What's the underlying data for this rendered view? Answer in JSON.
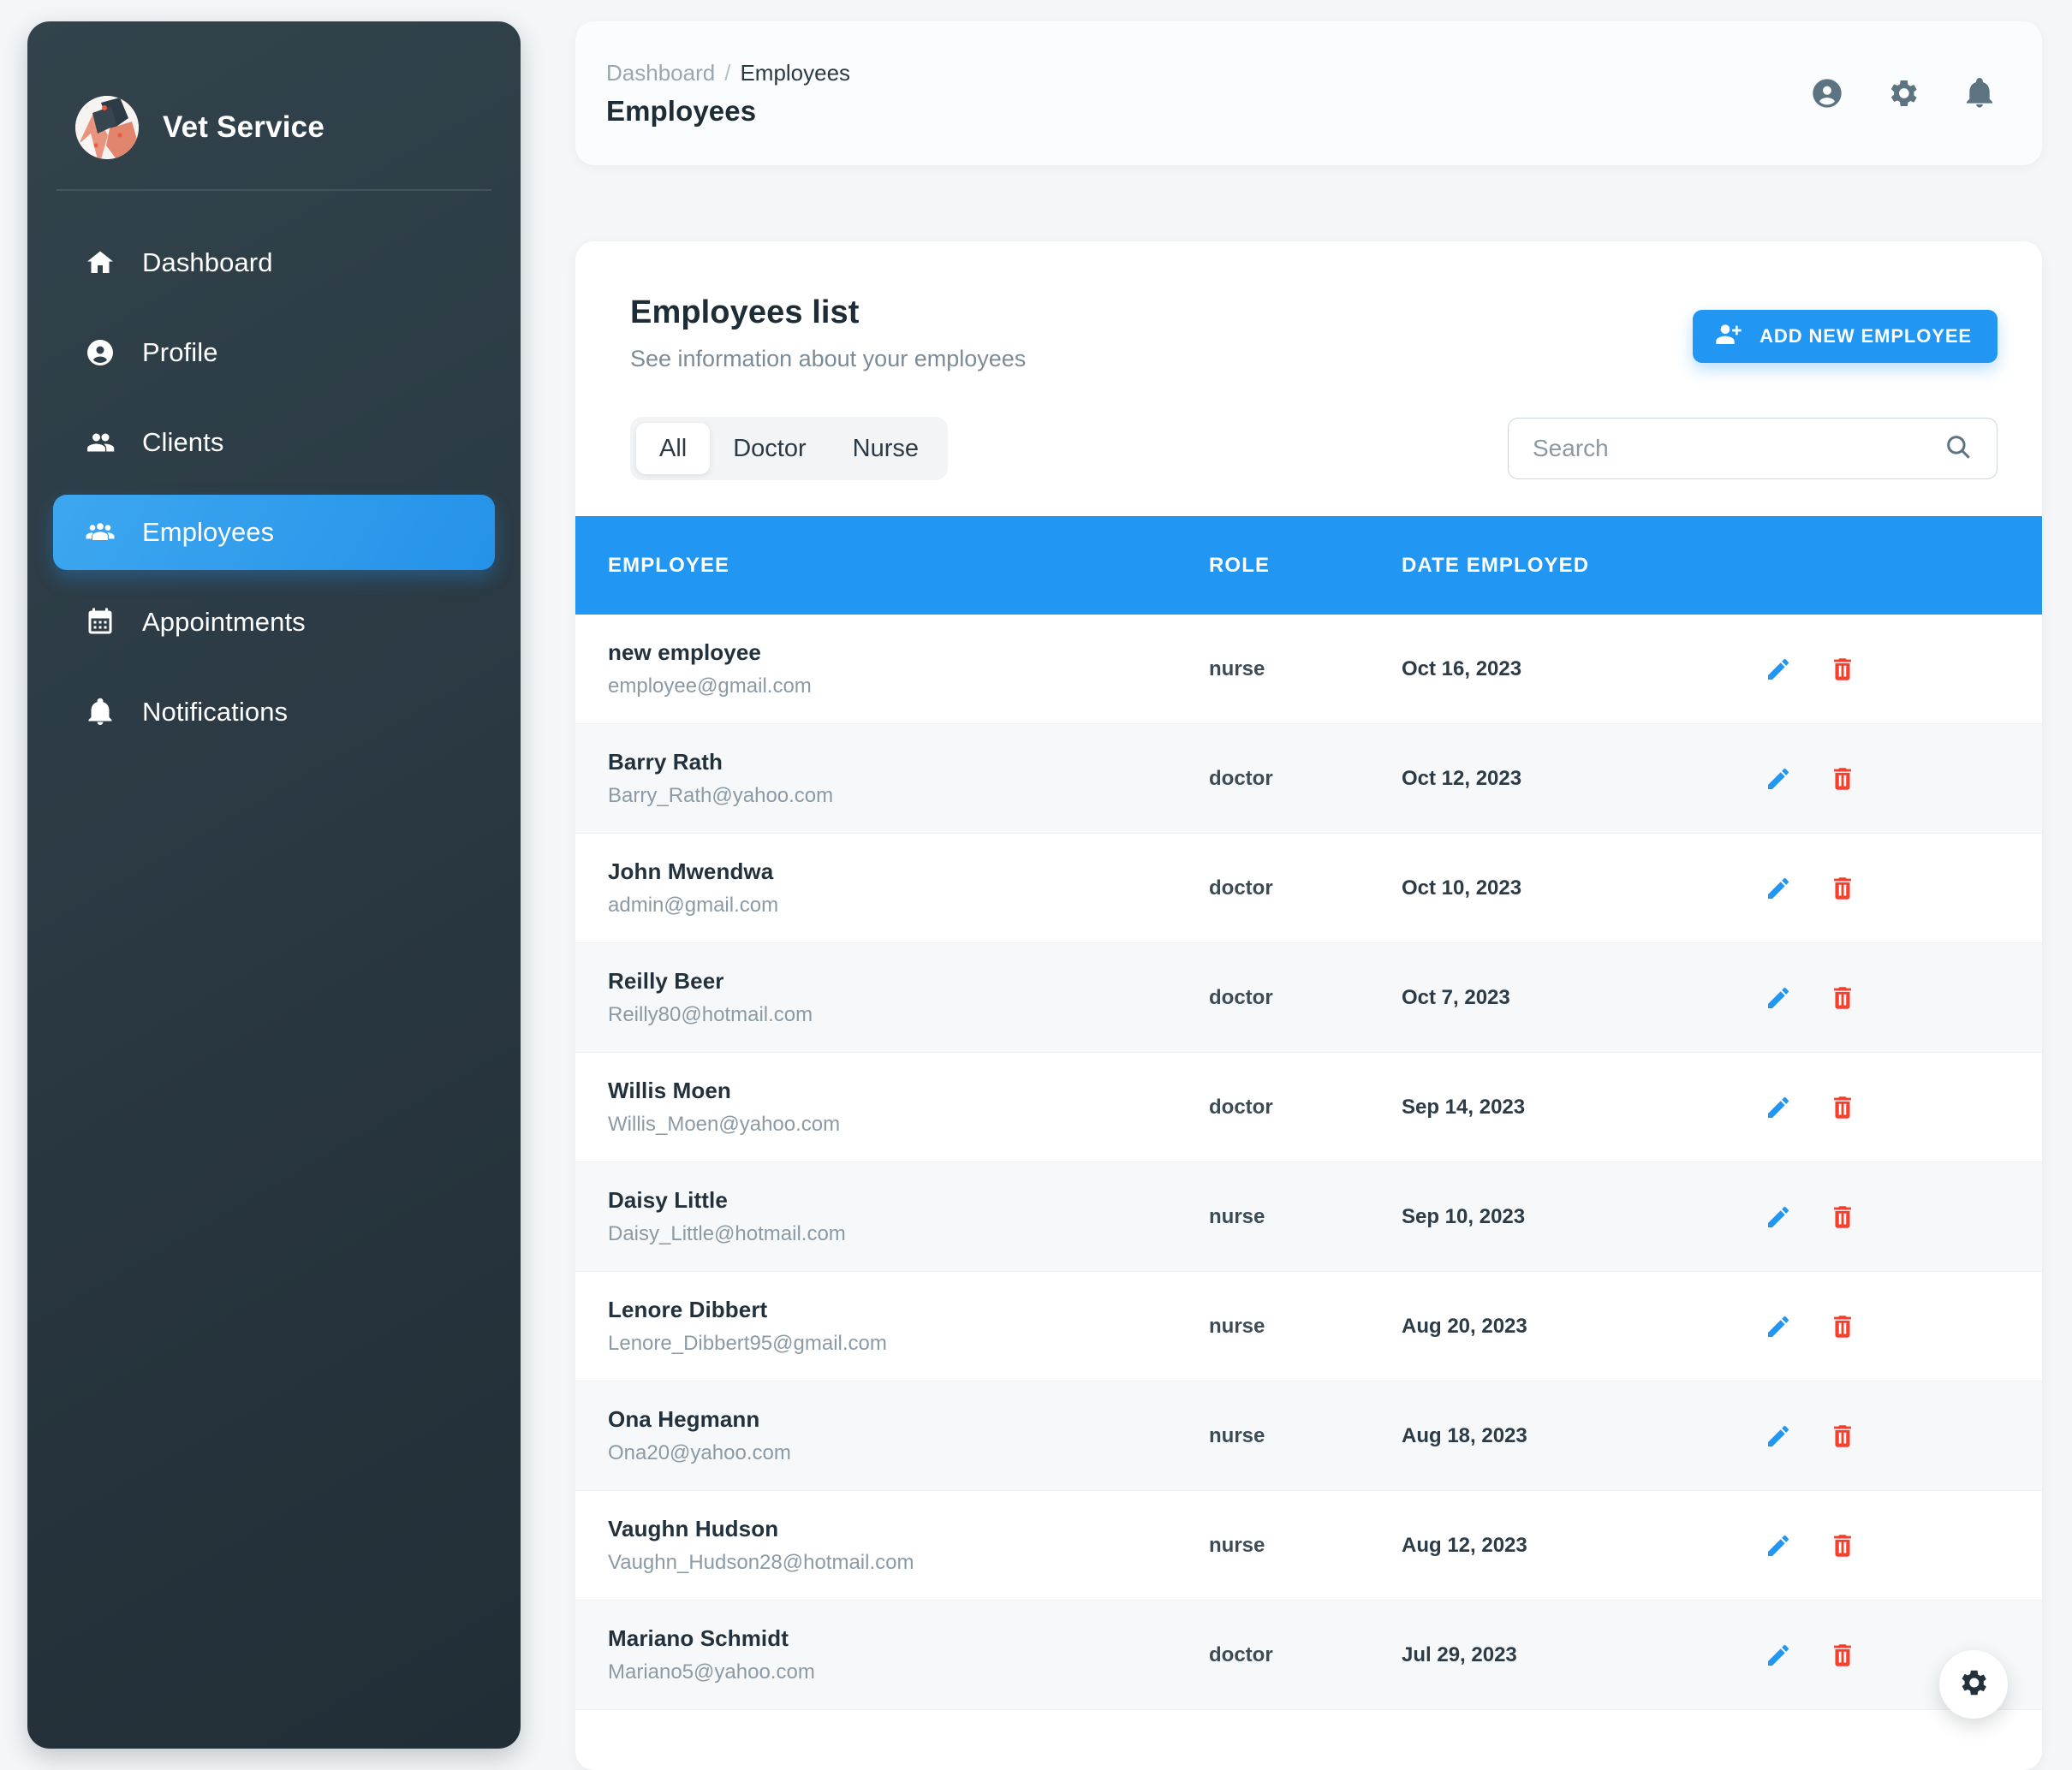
{
  "brand": {
    "title": "Vet Service",
    "avatar_icon": "dog-photo-avatar"
  },
  "sidebar": {
    "items": [
      {
        "label": "Dashboard",
        "icon": "home-icon",
        "active": false
      },
      {
        "label": "Profile",
        "icon": "person-circle-icon",
        "active": false
      },
      {
        "label": "Clients",
        "icon": "people-icon",
        "active": false
      },
      {
        "label": "Employees",
        "icon": "people-group-icon",
        "active": true
      },
      {
        "label": "Appointments",
        "icon": "calendar-icon",
        "active": false
      },
      {
        "label": "Notifications",
        "icon": "bell-icon",
        "active": false
      }
    ]
  },
  "topbar": {
    "breadcrumb_parent": "Dashboard",
    "breadcrumb_separator": "/",
    "breadcrumb_current": "Employees",
    "page_title": "Employees",
    "actions": [
      {
        "name": "account-icon"
      },
      {
        "name": "gear-icon"
      },
      {
        "name": "bell-icon"
      }
    ]
  },
  "card": {
    "title": "Employees list",
    "subtitle": "See information about your employees",
    "add_button_label": "ADD NEW EMPLOYEE",
    "add_button_icon": "person-add-icon"
  },
  "filters": {
    "tabs": [
      {
        "label": "All",
        "active": true
      },
      {
        "label": "Doctor",
        "active": false
      },
      {
        "label": "Nurse",
        "active": false
      }
    ]
  },
  "search": {
    "value": "",
    "placeholder": "Search",
    "icon": "search-icon"
  },
  "table": {
    "columns": [
      "EMPLOYEE",
      "ROLE",
      "DATE EMPLOYED"
    ],
    "row_actions": [
      {
        "name": "edit-icon",
        "color": "#2196f3"
      },
      {
        "name": "delete-icon",
        "color": "#f5402c"
      }
    ],
    "rows": [
      {
        "name": "new employee",
        "email": "employee@gmail.com",
        "role": "nurse",
        "date": "Oct 16, 2023"
      },
      {
        "name": "Barry Rath",
        "email": "Barry_Rath@yahoo.com",
        "role": "doctor",
        "date": "Oct 12, 2023"
      },
      {
        "name": "John Mwendwa",
        "email": "admin@gmail.com",
        "role": "doctor",
        "date": "Oct 10, 2023"
      },
      {
        "name": "Reilly Beer",
        "email": "Reilly80@hotmail.com",
        "role": "doctor",
        "date": "Oct 7, 2023"
      },
      {
        "name": "Willis Moen",
        "email": "Willis_Moen@yahoo.com",
        "role": "doctor",
        "date": "Sep 14, 2023"
      },
      {
        "name": "Daisy Little",
        "email": "Daisy_Little@hotmail.com",
        "role": "nurse",
        "date": "Sep 10, 2023"
      },
      {
        "name": "Lenore Dibbert",
        "email": "Lenore_Dibbert95@gmail.com",
        "role": "nurse",
        "date": "Aug 20, 2023"
      },
      {
        "name": "Ona Hegmann",
        "email": "Ona20@yahoo.com",
        "role": "nurse",
        "date": "Aug 18, 2023"
      },
      {
        "name": "Vaughn Hudson",
        "email": "Vaughn_Hudson28@hotmail.com",
        "role": "nurse",
        "date": "Aug 12, 2023"
      },
      {
        "name": "Mariano Schmidt",
        "email": "Mariano5@yahoo.com",
        "role": "doctor",
        "date": "Jul 29, 2023"
      }
    ]
  },
  "fab": {
    "icon": "gear-icon"
  },
  "colors": {
    "accent": "#2196f3",
    "sidebar": "#2c3b45",
    "danger": "#f5402c",
    "page_bg": "#f4f6f8"
  }
}
